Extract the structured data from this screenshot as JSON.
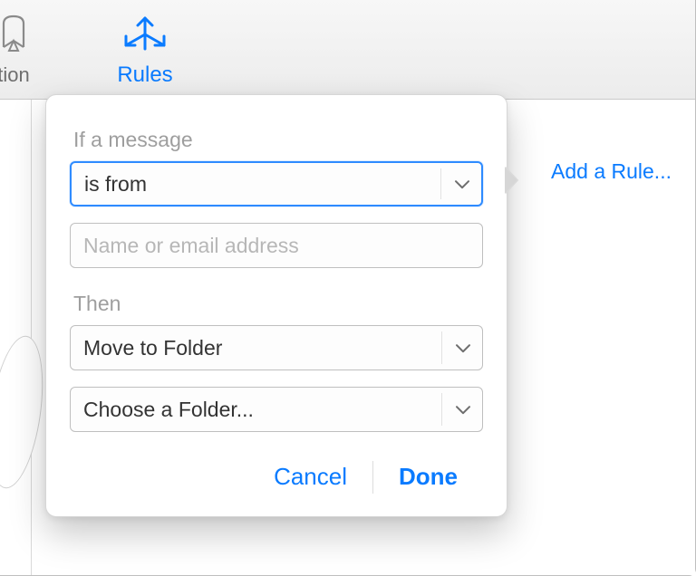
{
  "toolbar": {
    "left_item_label_fragment": "tion",
    "rules_label": "Rules"
  },
  "sidebar": {
    "add_rule_label": "Add a Rule..."
  },
  "popover": {
    "condition_label": "If a message",
    "condition_select_value": "is from",
    "address_placeholder": "Name or email address",
    "action_label": "Then",
    "action_select_value": "Move to Folder",
    "folder_select_value": "Choose a Folder...",
    "cancel_label": "Cancel",
    "done_label": "Done"
  },
  "colors": {
    "accent": "#0a7bff",
    "focus_ring": "#2e8bff"
  }
}
